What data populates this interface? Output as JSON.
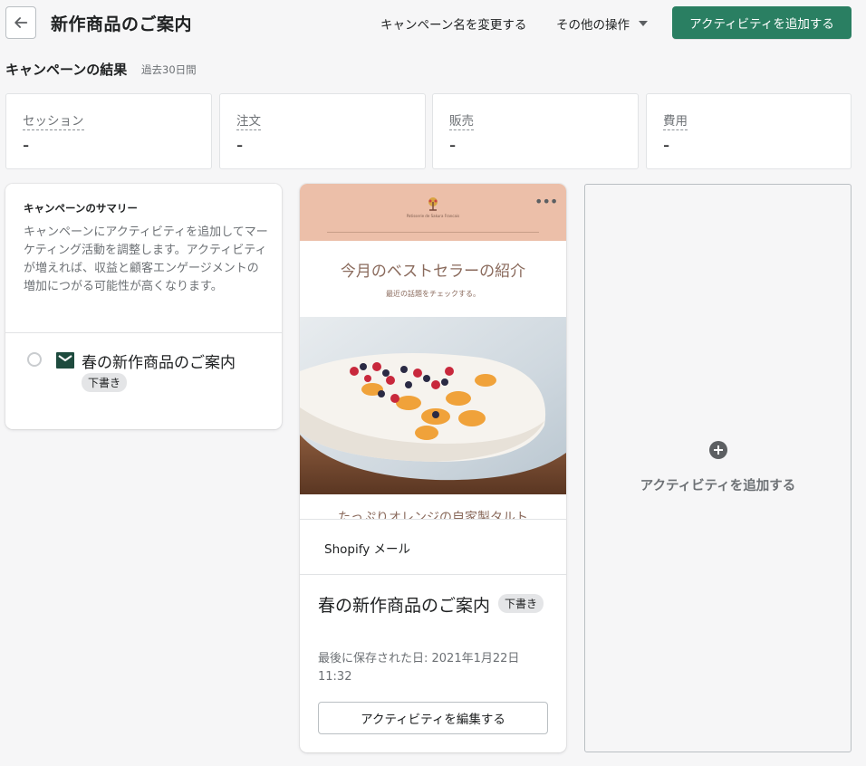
{
  "header": {
    "back_icon": "arrow-left-icon",
    "title": "新作商品のご案内",
    "rename_label": "キャンペーン名を変更する",
    "more_actions_label": "その他の操作",
    "add_activity_label": "アクティビティを追加する",
    "accent_color": "#2a7f62"
  },
  "results": {
    "title": "キャンペーンの結果",
    "period": "過去30日間",
    "metrics": [
      {
        "label": "セッション",
        "value": "-"
      },
      {
        "label": "注文",
        "value": "-"
      },
      {
        "label": "販売",
        "value": "-"
      },
      {
        "label": "費用",
        "value": "-"
      }
    ]
  },
  "summary": {
    "title": "キャンペーンのサマリー",
    "description": "キャンペーンにアクティビティを追加してマーケティング活動を調整します。アクティビティが増えれば、収益と顧客エンゲージメントの増加につがる可能性が高くなります。",
    "activity_title": "春の新作商品のご案内",
    "activity_badge": "下書き",
    "activity_icon": "mail-icon"
  },
  "activity_card": {
    "preview_logo_text": "Patisserie de Sakura Francais",
    "preview_heading": "今月のベストセラーの紹介",
    "preview_subheading": "最近の話題をチェックする。",
    "preview_caption": "たっぷりオレンジの自家製タルト",
    "menu_icon": "more-horizontal-icon",
    "channel": "Shopify メール",
    "name": "春の新作商品のご案内",
    "badge": "下書き",
    "saved_text": "最後に保存された日: 2021年1月22日 11:32",
    "edit_label": "アクティビティを編集する"
  },
  "add_activity": {
    "label": "アクティビティを追加する",
    "icon": "plus-circle-icon"
  }
}
